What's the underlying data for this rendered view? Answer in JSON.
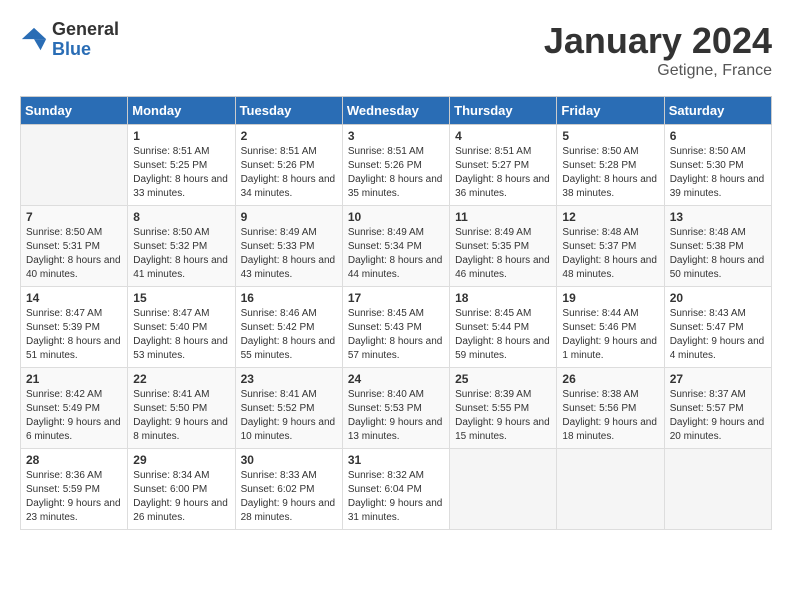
{
  "header": {
    "logo": {
      "general": "General",
      "blue": "Blue"
    },
    "title": "January 2024",
    "location": "Getigne, France"
  },
  "days_of_week": [
    "Sunday",
    "Monday",
    "Tuesday",
    "Wednesday",
    "Thursday",
    "Friday",
    "Saturday"
  ],
  "weeks": [
    [
      {
        "day": "",
        "sunrise": "",
        "sunset": "",
        "daylight": "",
        "empty": true
      },
      {
        "day": "1",
        "sunrise": "Sunrise: 8:51 AM",
        "sunset": "Sunset: 5:25 PM",
        "daylight": "Daylight: 8 hours and 33 minutes."
      },
      {
        "day": "2",
        "sunrise": "Sunrise: 8:51 AM",
        "sunset": "Sunset: 5:26 PM",
        "daylight": "Daylight: 8 hours and 34 minutes."
      },
      {
        "day": "3",
        "sunrise": "Sunrise: 8:51 AM",
        "sunset": "Sunset: 5:26 PM",
        "daylight": "Daylight: 8 hours and 35 minutes."
      },
      {
        "day": "4",
        "sunrise": "Sunrise: 8:51 AM",
        "sunset": "Sunset: 5:27 PM",
        "daylight": "Daylight: 8 hours and 36 minutes."
      },
      {
        "day": "5",
        "sunrise": "Sunrise: 8:50 AM",
        "sunset": "Sunset: 5:28 PM",
        "daylight": "Daylight: 8 hours and 38 minutes."
      },
      {
        "day": "6",
        "sunrise": "Sunrise: 8:50 AM",
        "sunset": "Sunset: 5:30 PM",
        "daylight": "Daylight: 8 hours and 39 minutes."
      }
    ],
    [
      {
        "day": "7",
        "sunrise": "Sunrise: 8:50 AM",
        "sunset": "Sunset: 5:31 PM",
        "daylight": "Daylight: 8 hours and 40 minutes."
      },
      {
        "day": "8",
        "sunrise": "Sunrise: 8:50 AM",
        "sunset": "Sunset: 5:32 PM",
        "daylight": "Daylight: 8 hours and 41 minutes."
      },
      {
        "day": "9",
        "sunrise": "Sunrise: 8:49 AM",
        "sunset": "Sunset: 5:33 PM",
        "daylight": "Daylight: 8 hours and 43 minutes."
      },
      {
        "day": "10",
        "sunrise": "Sunrise: 8:49 AM",
        "sunset": "Sunset: 5:34 PM",
        "daylight": "Daylight: 8 hours and 44 minutes."
      },
      {
        "day": "11",
        "sunrise": "Sunrise: 8:49 AM",
        "sunset": "Sunset: 5:35 PM",
        "daylight": "Daylight: 8 hours and 46 minutes."
      },
      {
        "day": "12",
        "sunrise": "Sunrise: 8:48 AM",
        "sunset": "Sunset: 5:37 PM",
        "daylight": "Daylight: 8 hours and 48 minutes."
      },
      {
        "day": "13",
        "sunrise": "Sunrise: 8:48 AM",
        "sunset": "Sunset: 5:38 PM",
        "daylight": "Daylight: 8 hours and 50 minutes."
      }
    ],
    [
      {
        "day": "14",
        "sunrise": "Sunrise: 8:47 AM",
        "sunset": "Sunset: 5:39 PM",
        "daylight": "Daylight: 8 hours and 51 minutes."
      },
      {
        "day": "15",
        "sunrise": "Sunrise: 8:47 AM",
        "sunset": "Sunset: 5:40 PM",
        "daylight": "Daylight: 8 hours and 53 minutes."
      },
      {
        "day": "16",
        "sunrise": "Sunrise: 8:46 AM",
        "sunset": "Sunset: 5:42 PM",
        "daylight": "Daylight: 8 hours and 55 minutes."
      },
      {
        "day": "17",
        "sunrise": "Sunrise: 8:45 AM",
        "sunset": "Sunset: 5:43 PM",
        "daylight": "Daylight: 8 hours and 57 minutes."
      },
      {
        "day": "18",
        "sunrise": "Sunrise: 8:45 AM",
        "sunset": "Sunset: 5:44 PM",
        "daylight": "Daylight: 8 hours and 59 minutes."
      },
      {
        "day": "19",
        "sunrise": "Sunrise: 8:44 AM",
        "sunset": "Sunset: 5:46 PM",
        "daylight": "Daylight: 9 hours and 1 minute."
      },
      {
        "day": "20",
        "sunrise": "Sunrise: 8:43 AM",
        "sunset": "Sunset: 5:47 PM",
        "daylight": "Daylight: 9 hours and 4 minutes."
      }
    ],
    [
      {
        "day": "21",
        "sunrise": "Sunrise: 8:42 AM",
        "sunset": "Sunset: 5:49 PM",
        "daylight": "Daylight: 9 hours and 6 minutes."
      },
      {
        "day": "22",
        "sunrise": "Sunrise: 8:41 AM",
        "sunset": "Sunset: 5:50 PM",
        "daylight": "Daylight: 9 hours and 8 minutes."
      },
      {
        "day": "23",
        "sunrise": "Sunrise: 8:41 AM",
        "sunset": "Sunset: 5:52 PM",
        "daylight": "Daylight: 9 hours and 10 minutes."
      },
      {
        "day": "24",
        "sunrise": "Sunrise: 8:40 AM",
        "sunset": "Sunset: 5:53 PM",
        "daylight": "Daylight: 9 hours and 13 minutes."
      },
      {
        "day": "25",
        "sunrise": "Sunrise: 8:39 AM",
        "sunset": "Sunset: 5:55 PM",
        "daylight": "Daylight: 9 hours and 15 minutes."
      },
      {
        "day": "26",
        "sunrise": "Sunrise: 8:38 AM",
        "sunset": "Sunset: 5:56 PM",
        "daylight": "Daylight: 9 hours and 18 minutes."
      },
      {
        "day": "27",
        "sunrise": "Sunrise: 8:37 AM",
        "sunset": "Sunset: 5:57 PM",
        "daylight": "Daylight: 9 hours and 20 minutes."
      }
    ],
    [
      {
        "day": "28",
        "sunrise": "Sunrise: 8:36 AM",
        "sunset": "Sunset: 5:59 PM",
        "daylight": "Daylight: 9 hours and 23 minutes."
      },
      {
        "day": "29",
        "sunrise": "Sunrise: 8:34 AM",
        "sunset": "Sunset: 6:00 PM",
        "daylight": "Daylight: 9 hours and 26 minutes."
      },
      {
        "day": "30",
        "sunrise": "Sunrise: 8:33 AM",
        "sunset": "Sunset: 6:02 PM",
        "daylight": "Daylight: 9 hours and 28 minutes."
      },
      {
        "day": "31",
        "sunrise": "Sunrise: 8:32 AM",
        "sunset": "Sunset: 6:04 PM",
        "daylight": "Daylight: 9 hours and 31 minutes."
      },
      {
        "day": "",
        "sunrise": "",
        "sunset": "",
        "daylight": "",
        "empty": true
      },
      {
        "day": "",
        "sunrise": "",
        "sunset": "",
        "daylight": "",
        "empty": true
      },
      {
        "day": "",
        "sunrise": "",
        "sunset": "",
        "daylight": "",
        "empty": true
      }
    ]
  ]
}
